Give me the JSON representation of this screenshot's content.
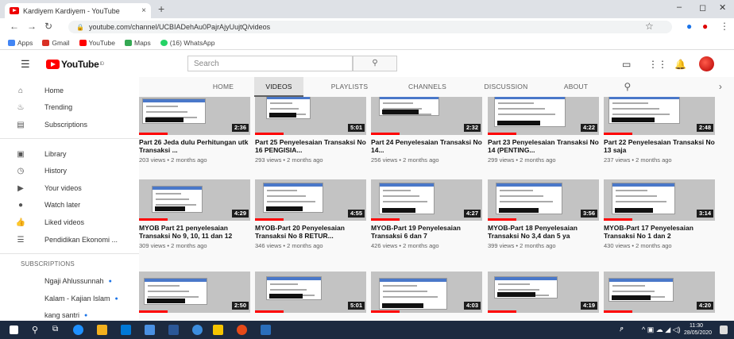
{
  "browser": {
    "tab_title": "Kardiyem Kardiyem - YouTube",
    "tab_close": "×",
    "new_tab": "+",
    "url": "youtube.com/channel/UCBIADehAu0PajrAjyUujtQ/videos",
    "win_min": "–",
    "win_max": "◻",
    "win_close": "✕"
  },
  "bookmarks": [
    {
      "label": "Apps",
      "color": "#4285f4"
    },
    {
      "label": "Gmail",
      "color": "#d93025"
    },
    {
      "label": "YouTube",
      "color": "#ff0000"
    },
    {
      "label": "Maps",
      "color": "#34a853"
    },
    {
      "label": "(16) WhatsApp",
      "color": "#25d366"
    }
  ],
  "header": {
    "logo": "YouTube",
    "logo_sup": "ID",
    "search_placeholder": "Search"
  },
  "sidebar": {
    "items": [
      {
        "label": "Home",
        "icon": "home-icon",
        "glyph": "⌂"
      },
      {
        "label": "Trending",
        "icon": "trending-icon",
        "glyph": "♨"
      },
      {
        "label": "Subscriptions",
        "icon": "subscriptions-icon",
        "glyph": "▤"
      },
      {
        "label": "Library",
        "icon": "library-icon",
        "glyph": "▣"
      },
      {
        "label": "History",
        "icon": "history-icon",
        "glyph": "◷"
      },
      {
        "label": "Your videos",
        "icon": "your-videos-icon",
        "glyph": "▶"
      },
      {
        "label": "Watch later",
        "icon": "watch-later-icon",
        "glyph": "●"
      },
      {
        "label": "Liked videos",
        "icon": "liked-videos-icon",
        "glyph": "👍"
      },
      {
        "label": "Pendidikan Ekonomi ...",
        "icon": "playlist-icon",
        "glyph": "☰"
      }
    ],
    "subscriptions_heading": "SUBSCRIPTIONS",
    "subscriptions": [
      {
        "label": "Ngaji Ahlussunnah",
        "color": "#2e7d32"
      },
      {
        "label": "Kalam - Kajian Islam",
        "color": "#1e88e5"
      },
      {
        "label": "kang santri",
        "color": "#7cb342"
      }
    ]
  },
  "channel_tabs": [
    "HOME",
    "VIDEOS",
    "PLAYLISTS",
    "CHANNELS",
    "DISCUSSION",
    "ABOUT"
  ],
  "videos": [
    {
      "title": "Part 26 Jeda dulu Perhitungan utk Transaksi ...",
      "meta": "203 views • 2 months ago",
      "duration": "2:36"
    },
    {
      "title": "Part 25 Penyelesaian Transaksi No 16 PENGISIA...",
      "meta": "293 views • 2 months ago",
      "duration": "5:01"
    },
    {
      "title": "Part 24 Penyelesaian Transaksi No 14...",
      "meta": "256 views • 2 months ago",
      "duration": "2:32"
    },
    {
      "title": "Part 23 Penyelesaian Transaksi No 14 (PENTING...",
      "meta": "299 views • 2 months ago",
      "duration": "4:22"
    },
    {
      "title": "Part 22 Penyelesaian Transaksi No 13 saja",
      "meta": "237 views • 2 months ago",
      "duration": "2:48"
    },
    {
      "title": "MYOB Part 21 penyelesaian Transaksi No 9, 10, 11 dan 12",
      "meta": "309 views • 2 months ago",
      "duration": "4:29"
    },
    {
      "title": "MYOB-Part 20 Penyelesaian Transaksi No 8 RETUR...",
      "meta": "346 views • 2 months ago",
      "duration": "4:55"
    },
    {
      "title": "MYOB-Part 19 Penyelesaian Transaksi 6 dan 7",
      "meta": "426 views • 2 months ago",
      "duration": "4:27"
    },
    {
      "title": "MYOB-Part 18 Penyelesaian Transaksi No 3,4 dan 5 ya",
      "meta": "399 views • 2 months ago",
      "duration": "3:56"
    },
    {
      "title": "MYOB-Part 17 Penyelesaian Transaksi No 1 dan 2",
      "meta": "430 views • 2 months ago",
      "duration": "3:14"
    },
    {
      "title": "",
      "meta": "",
      "duration": "2:50"
    },
    {
      "title": "",
      "meta": "",
      "duration": "5:01"
    },
    {
      "title": "",
      "meta": "",
      "duration": "4:03"
    },
    {
      "title": "",
      "meta": "",
      "duration": "4:19"
    },
    {
      "title": "",
      "meta": "",
      "duration": "4:20"
    }
  ],
  "taskbar": {
    "time": "11:30",
    "date": "28/05/2020"
  }
}
